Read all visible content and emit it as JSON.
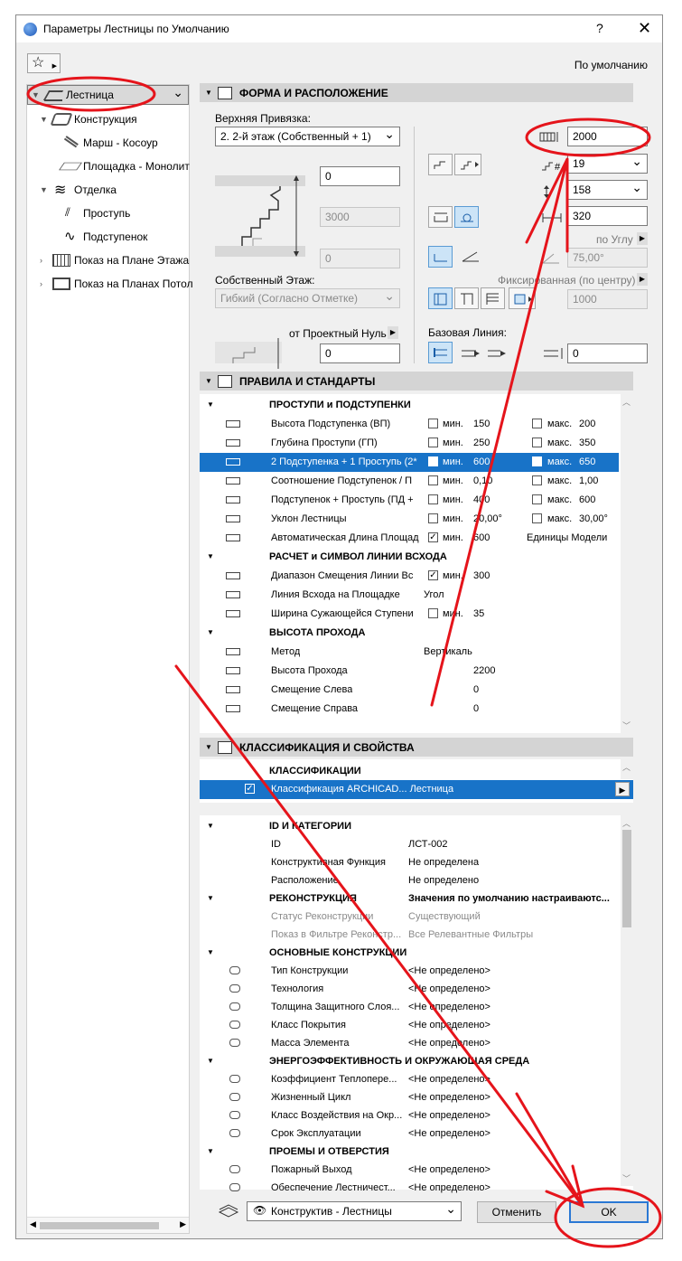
{
  "window": {
    "title": "Параметры Лестницы по Умолчанию",
    "help": "?",
    "close": "✕"
  },
  "topbar": {
    "favorites_icon": "☆",
    "default_label": "По умолчанию"
  },
  "tree": [
    {
      "label": "Лестница",
      "icon": "stair-icon",
      "expanded": true,
      "selected": true
    },
    {
      "label": "Конструкция",
      "icon": "structure-icon",
      "expanded": true
    },
    {
      "label": "Марш - Косоур",
      "icon": "flight-icon"
    },
    {
      "label": "Площадка - Монолит",
      "icon": "landing-icon"
    },
    {
      "label": "Отделка",
      "icon": "finish-icon",
      "expanded": true
    },
    {
      "label": "Проступь",
      "icon": "tread-icon"
    },
    {
      "label": "Подступенок",
      "icon": "riser-icon"
    },
    {
      "label": "Показ на Плане Этажа",
      "icon": "floor-plan-icon",
      "expanded": false
    },
    {
      "label": "Показ на Планах Потол",
      "icon": "ceiling-plan-icon",
      "expanded": false
    }
  ],
  "shape": {
    "header": "ФОРМА И РАСПОЛОЖЕНИЕ",
    "top_link_label": "Верхняя Привязка:",
    "top_link_value": "2. 2-й этаж (Собственный + 1)",
    "offset_top": "0",
    "height": "3000",
    "offset_bottom": "0",
    "home_story_label": "Собственный Этаж:",
    "home_story_value": "Гибкий (Согласно Отметке)",
    "project_zero_label": "от Проектный Нуль",
    "project_zero_value": "0",
    "width_value": "2000",
    "risers_value": "19",
    "riser_height_value": "158",
    "going_value": "320",
    "angle_label": "по Углу",
    "angle_value": "75,00°",
    "fixed_label": "Фиксированная (по центру)",
    "fixed_value": "1000",
    "baseline_label": "Базовая Линия:",
    "baseline_offset": "0"
  },
  "rules": {
    "header": "ПРАВИЛА И СТАНДАРТЫ",
    "groups": [
      {
        "title": "ПРОСТУПИ и ПОДСТУПЕНКИ"
      },
      {
        "title": "РАСЧЕТ и СИМВОЛ ЛИНИИ ВСХОДА"
      },
      {
        "title": "ВЫСОТА ПРОХОДА"
      }
    ],
    "rows": [
      {
        "name": "Высота Подступенка (ВП)",
        "min_label": "мин.",
        "min": "150",
        "max_label": "макс.",
        "max": "200"
      },
      {
        "name": "Глубина Проступи (ГП)",
        "min_label": "мин.",
        "min": "250",
        "max_label": "макс.",
        "max": "350"
      },
      {
        "name": "2 Подступенка + 1 Проступь (2*",
        "min_label": "мин.",
        "min": "600",
        "max_label": "макс.",
        "max": "650"
      },
      {
        "name": "Соотношение Подступенок / П",
        "min_label": "мин.",
        "min": "0,10",
        "max_label": "макс.",
        "max": "1,00"
      },
      {
        "name": "Подступенок + Проступь (ПД +",
        "min_label": "мин.",
        "min": "400",
        "max_label": "макс.",
        "max": "600"
      },
      {
        "name": "Уклон Лестницы",
        "min_label": "мин.",
        "min": "20,00°",
        "max_label": "макс.",
        "max": "30,00°"
      },
      {
        "name": "Автоматическая Длина Площад",
        "min_label": "мин.",
        "min": "600",
        "max_label": "Единицы Модели",
        "max": ""
      }
    ],
    "walking_rows": [
      {
        "name": "Диапазон Смещения Линии Вс",
        "min_label": "мин.",
        "value": "300"
      },
      {
        "name": "Линия Всхода на Площадке",
        "value": "Угол"
      },
      {
        "name": "Ширина Сужающейся Ступени",
        "min_label": "мин.",
        "value": "35"
      }
    ],
    "headroom_rows": [
      {
        "name": "Метод",
        "value": "Вертикаль"
      },
      {
        "name": "Высота Прохода",
        "value": "2200"
      },
      {
        "name": "Смещение Слева",
        "value": "0"
      },
      {
        "name": "Смещение Справа",
        "value": "0"
      }
    ]
  },
  "classification": {
    "header": "КЛАССИФИКАЦИЯ И СВОЙСТВА",
    "group": "КЛАССИФИКАЦИИ",
    "row": "Классификация ARCHICAD... Лестница",
    "arrow": "▶"
  },
  "properties": {
    "groups": [
      {
        "title": "ID И КАТЕГОРИИ",
        "rows": [
          {
            "name": "ID",
            "value": "ЛСТ-002"
          },
          {
            "name": "Конструктивная Функция",
            "value": "Не определена"
          },
          {
            "name": "Расположение",
            "value": "Не определено"
          }
        ]
      },
      {
        "title": "РЕКОНСТРУКЦИЯ",
        "value": "Значения по умолчанию настраиваютс...",
        "rows": [
          {
            "name": "Статус Реконструкции",
            "value": "Существующий"
          },
          {
            "name": "Показ в Фильтре Реконстр...",
            "value": "Все Релевантные Фильтры"
          }
        ]
      },
      {
        "title": "ОСНОВНЫЕ КОНСТРУКЦИИ",
        "rows": [
          {
            "name": "Тип Конструкции",
            "value": "<Не определено>"
          },
          {
            "name": "Технология",
            "value": "<Не определено>"
          },
          {
            "name": "Толщина Защитного Слоя...",
            "value": "<Не определено>"
          },
          {
            "name": "Класс Покрытия",
            "value": "<Не определено>"
          },
          {
            "name": "Масса Элемента",
            "value": "<Не определено>"
          }
        ]
      },
      {
        "title": "ЭНЕРГОЭФФЕКТИВНОСТЬ И ОКРУЖАЮЩАЯ СРЕДА",
        "rows": [
          {
            "name": "Коэффициент Теплопере...",
            "value": "<Не определено>"
          },
          {
            "name": "Жизненный Цикл",
            "value": "<Не определено>"
          },
          {
            "name": "Класс Воздействия на Окр...",
            "value": "<Не определено>"
          },
          {
            "name": "Срок Эксплуатации",
            "value": "<Не определено>"
          }
        ]
      },
      {
        "title": "ПРОЕМЫ И ОТВЕРСТИЯ",
        "rows": [
          {
            "name": "Пожарный Выход",
            "value": "<Не определено>"
          },
          {
            "name": "Обеспечение Лестничест...",
            "value": "<Не определено>"
          }
        ]
      }
    ]
  },
  "footer": {
    "layer_value": "Конструктив - Лестницы",
    "cancel": "Отменить",
    "ok": "OK"
  },
  "colors": {
    "selection": "#1873c8",
    "annotation": "#e5141b",
    "section_header": "#d4d4d4"
  }
}
